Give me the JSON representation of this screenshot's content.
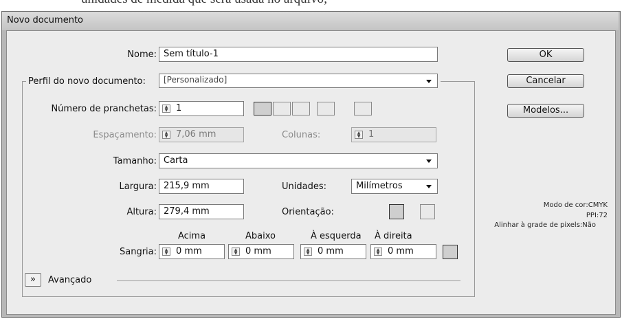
{
  "background_text": "unidades de medida que será usada no arquivo;",
  "dialog": {
    "title": "Novo documento"
  },
  "nome": {
    "label": "Nome:",
    "value": "Sem título-1"
  },
  "perfil": {
    "label": "Perfil do novo documento:",
    "value": "[Personalizado]"
  },
  "pranchetas": {
    "label": "Número de pranchetas:",
    "value": "1"
  },
  "espacamento": {
    "label": "Espaçamento:",
    "value": "7,06 mm"
  },
  "colunas": {
    "label": "Colunas:",
    "value": "1"
  },
  "tamanho": {
    "label": "Tamanho:",
    "value": "Carta"
  },
  "largura": {
    "label": "Largura:",
    "value": "215,9 mm"
  },
  "unidades": {
    "label": "Unidades:",
    "value": "Milímetros"
  },
  "altura": {
    "label": "Altura:",
    "value": "279,4 mm"
  },
  "orientacao": {
    "label": "Orientação:"
  },
  "sangria": {
    "label": "Sangria:",
    "headers": {
      "top": "Acima",
      "bottom": "Abaixo",
      "left": "À esquerda",
      "right": "À direita"
    },
    "values": {
      "top": "0 mm",
      "bottom": "0 mm",
      "left": "0 mm",
      "right": "0 mm"
    }
  },
  "avancado": {
    "label": "Avançado"
  },
  "buttons": {
    "ok": "OK",
    "cancel": "Cancelar",
    "models": "Modelos..."
  },
  "info": {
    "color_mode": "Modo de cor:CMYK",
    "ppi": "PPI:72",
    "pixel_grid": "Alinhar à grade de pixels:Não"
  }
}
